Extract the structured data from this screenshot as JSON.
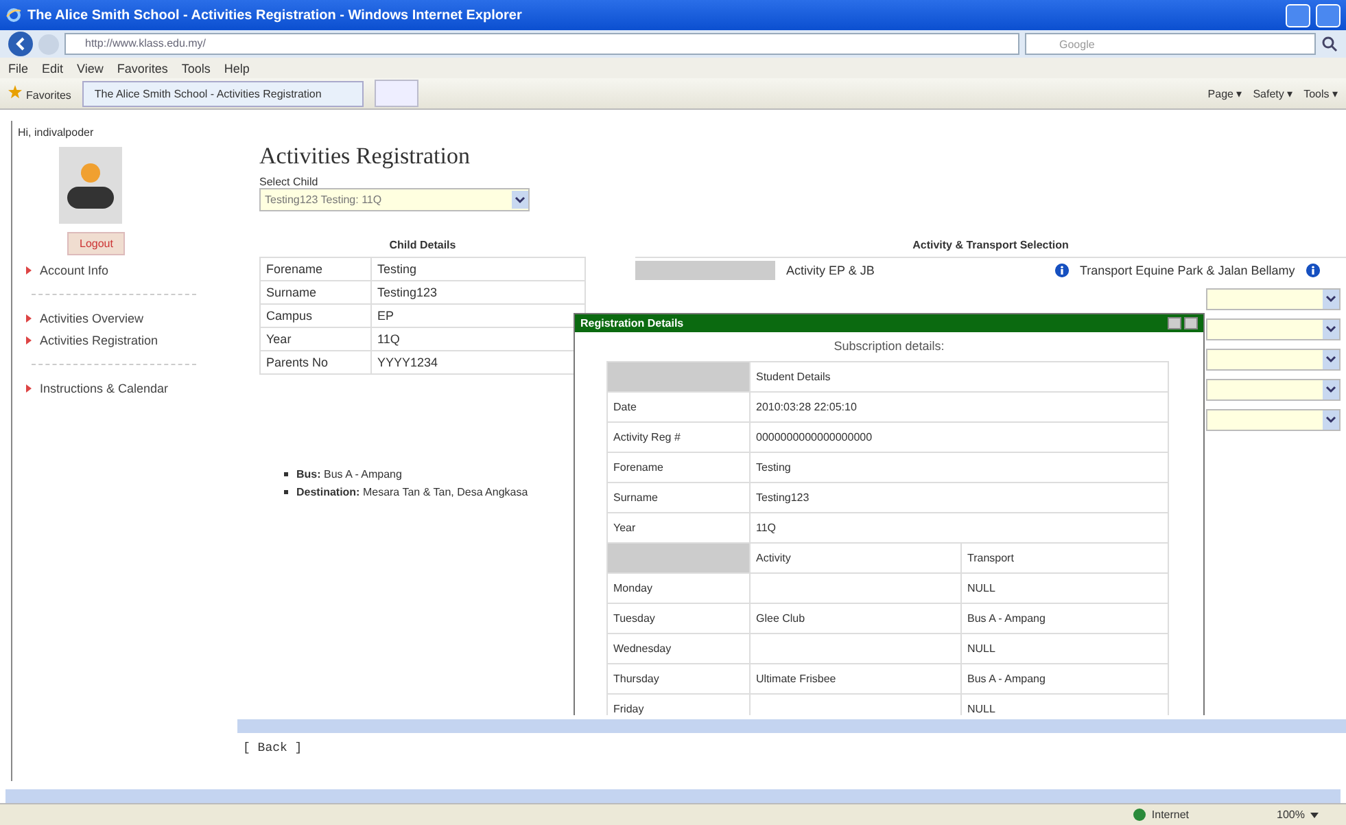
{
  "window": {
    "title": "The Alice Smith School - Activities Registration - Windows Internet Explorer"
  },
  "address_bar": {
    "url": "http://www.klass.edu.my/",
    "search_placeholder": "Google"
  },
  "menu": [
    "File",
    "Edit",
    "View",
    "Favorites",
    "Tools",
    "Help"
  ],
  "favorites_bar": {
    "favorites": "Favorites",
    "tab": "The Alice Smith School - Activities Registration",
    "commands": [
      "Page ▾",
      "Safety ▾",
      "Tools ▾"
    ]
  },
  "sidebar": {
    "greeting": "Hi, indivalpoder",
    "logout": "Logout",
    "items": [
      {
        "label": "Account Info",
        "separator_after": true
      },
      {
        "label": "Activities Overview",
        "separator_after": false
      },
      {
        "label": "Activities Registration",
        "separator_after": true
      },
      {
        "label": "Instructions & Calendar",
        "separator_after": false
      }
    ]
  },
  "main": {
    "heading": "Activities Registration",
    "select_child": {
      "label": "Select Child",
      "value": "Testing123 Testing: 11Q"
    },
    "child_details": {
      "title": "Child Details",
      "rows": [
        {
          "label": "Forename",
          "value": "Testing"
        },
        {
          "label": "Surname",
          "value": "Testing123"
        },
        {
          "label": "Campus",
          "value": "EP"
        },
        {
          "label": "Year",
          "value": "11Q"
        },
        {
          "label": "Parents No",
          "value": "YYYY1234"
        }
      ]
    },
    "selection": {
      "title": "Activity & Transport Selection",
      "activity_label": "Activity EP & JB",
      "transport_label": "Transport Equine Park & Jalan Bellamy",
      "selects": [
        {
          "kind": "select"
        },
        {
          "kind": "select"
        },
        {
          "kind": "select"
        },
        {
          "kind": "select"
        },
        {
          "kind": "select"
        }
      ]
    },
    "bus_info": [
      "**Bus:** Bus A - Ampang",
      "**Destination:** Mesara Tan & Tan, Desa Angkasa"
    ],
    "back": "[ Back ]"
  },
  "dialog": {
    "title": "Registration Details",
    "subtitle": "Subscription details:",
    "details_header": "Student Details",
    "details": [
      {
        "label": "Date",
        "value": "2010:03:28 22:05:10"
      },
      {
        "label": "Activity Reg #",
        "value": "0000000000000000000"
      },
      {
        "label": "Forename",
        "value": "Testing"
      },
      {
        "label": "Surname",
        "value": "Testing123"
      },
      {
        "label": "Year",
        "value": "11Q"
      }
    ],
    "schedule_headers": [
      "Activity",
      "Transport"
    ],
    "schedule": [
      {
        "day": "Monday",
        "transport": "NULL"
      },
      {
        "day": "Tuesday",
        "activity": "Glee Club",
        "transport": "Bus A - Ampang"
      },
      {
        "day": "Wednesday",
        "transport": "NULL"
      },
      {
        "day": "Thursday",
        "activity": "Ultimate Frisbee",
        "transport": "Bus A - Ampang"
      },
      {
        "day": "Friday",
        "transport": "NULL"
      }
    ]
  },
  "status_bar": {
    "zone": "Internet",
    "zoom": "100%"
  }
}
